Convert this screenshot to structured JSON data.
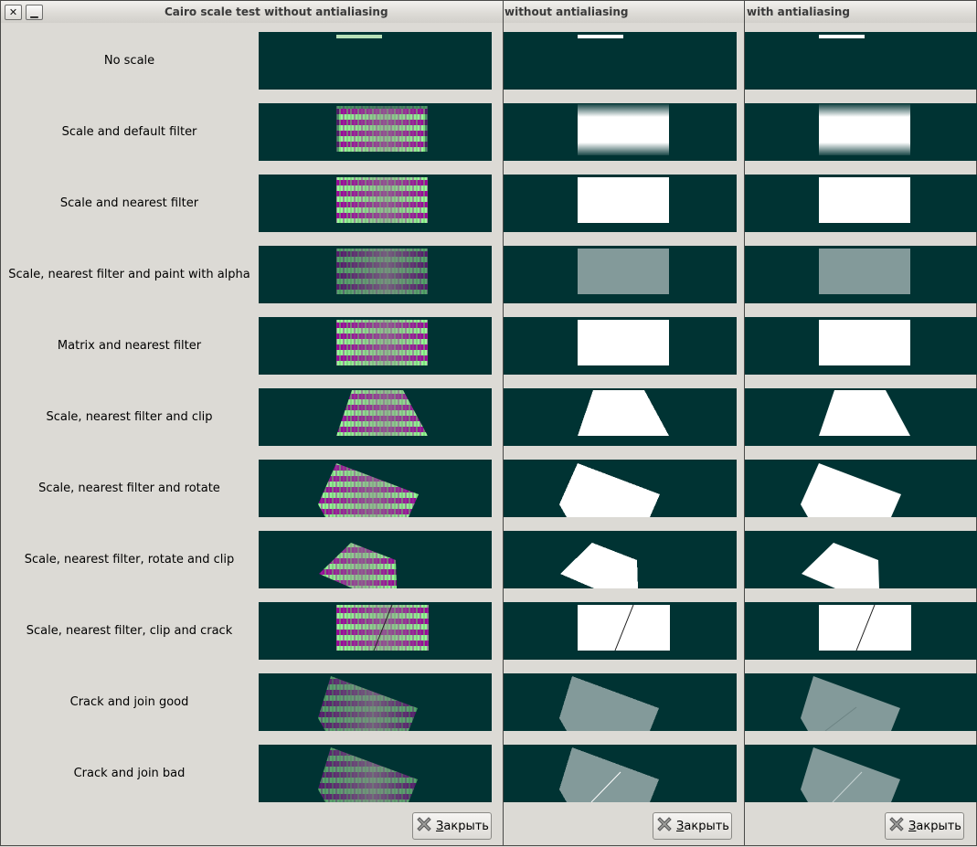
{
  "windows": [
    {
      "title": "Cairo scale test without antialiasing",
      "mode": "pattern"
    },
    {
      "title": "without antialiasing",
      "mode": "white_noaa"
    },
    {
      "title": "with antialiasing",
      "mode": "white_aa"
    }
  ],
  "window_buttons": {
    "close": "✕",
    "minimize": "▁"
  },
  "rows": [
    {
      "label": "No scale",
      "shape": "noscale"
    },
    {
      "label": "Scale and default filter",
      "shape": "blur"
    },
    {
      "label": "Scale and nearest filter",
      "shape": "rect"
    },
    {
      "label": "Scale, nearest filter and paint with alpha",
      "shape": "alpha"
    },
    {
      "label": "Matrix and nearest filter",
      "shape": "rect"
    },
    {
      "label": "Scale, nearest filter and clip",
      "shape": "trap"
    },
    {
      "label": "Scale, nearest filter and rotate",
      "shape": "rot"
    },
    {
      "label": "Scale, nearest filter, rotate and clip",
      "shape": "rotclip"
    },
    {
      "label": "Scale, nearest filter, clip and crack",
      "shape": "crack"
    },
    {
      "label": "Crack and join good",
      "shape": "cjgood"
    },
    {
      "label": "Crack and join bad",
      "shape": "cjbad"
    }
  ],
  "close_button": {
    "label_prefix": "",
    "mnemonic": "З",
    "label_rest": "акрыть"
  },
  "colors": {
    "panel_bg": "#003333",
    "window_bg": "#dcdad5",
    "fg_white": "#ffffff",
    "alpha_fill": "#839a9a",
    "stripe_green": "#99ff99",
    "stripe_magenta": "#990099"
  }
}
